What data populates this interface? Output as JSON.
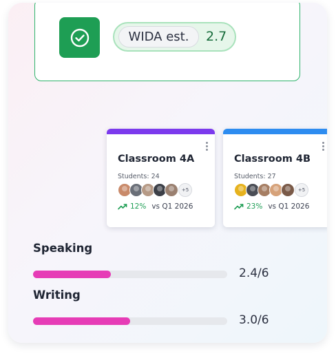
{
  "status": {
    "pill_label": "WIDA est.",
    "pill_value": "2.7",
    "colors": {
      "accent": "#1e9e54",
      "border": "#2fb36b"
    }
  },
  "classrooms": [
    {
      "name": "Classroom 4A",
      "students_label": "Students: 24",
      "more_count": "+5",
      "change": "12%",
      "compare": "vs Q1 2026",
      "accent": "#7c3aed"
    },
    {
      "name": "Classroom 4B",
      "students_label": "Students: 27",
      "more_count": "+5",
      "change": "23%",
      "compare": "vs Q1 2026",
      "accent": "#2d8cf0"
    }
  ],
  "skills": [
    {
      "label": "Speaking",
      "value": "2.4/6",
      "fraction": 0.4
    },
    {
      "label": "Writing",
      "value": "3.0/6",
      "fraction": 0.5
    }
  ],
  "colors": {
    "progress": "#e63cb6",
    "trend_up": "#1e9e54"
  }
}
